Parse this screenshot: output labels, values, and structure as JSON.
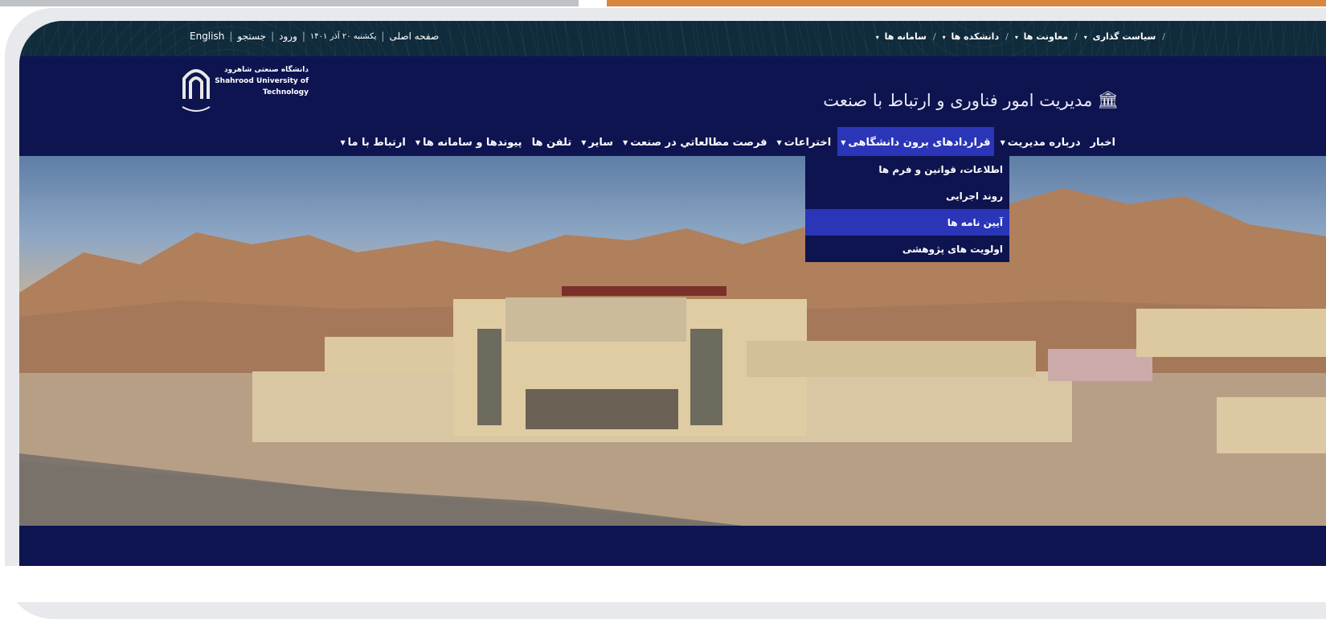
{
  "topbar": {
    "english": "English",
    "search": "جستجو",
    "login": "ورود",
    "date": "یکشنبه ۲۰ آذر ۱۴۰۱",
    "home": "صفحه اصلی",
    "right_links": [
      "سیاست گذاری",
      "معاونت ها",
      "دانشکده ها",
      "سامانه ها"
    ]
  },
  "header": {
    "university_fa": "دانشگاه صنعتی شاهرود",
    "university_en_1": "Shahrood University of",
    "university_en_2": "Technology",
    "site_title": "مدیریت امور فناوری و ارتباط با صنعت",
    "title_icon": "university-icon"
  },
  "nav": {
    "items": [
      {
        "label": "اخبار",
        "has_caret": false,
        "active": false
      },
      {
        "label": "درباره مدیریت",
        "has_caret": true,
        "active": false
      },
      {
        "label": "قراردادهای برون دانشگاهی",
        "has_caret": true,
        "active": true
      },
      {
        "label": "اختراعات",
        "has_caret": true,
        "active": false
      },
      {
        "label": "فرصت مطالعاتي در صنعت",
        "has_caret": true,
        "active": false
      },
      {
        "label": "سایر",
        "has_caret": true,
        "active": false
      },
      {
        "label": "تلفن ها",
        "has_caret": false,
        "active": false
      },
      {
        "label": "پیوندها و سامانه ها",
        "has_caret": true,
        "active": false
      },
      {
        "label": "ارتباط با ما",
        "has_caret": true,
        "active": false
      }
    ]
  },
  "dropdown": {
    "items": [
      {
        "label": "اطلاعات، قوانین و فرم ها",
        "active": false
      },
      {
        "label": "روند اجرایی",
        "active": false
      },
      {
        "label": "آیین نامه ها",
        "active": true
      },
      {
        "label": "اولویت های پژوهشی",
        "active": false
      }
    ]
  },
  "colors": {
    "navy": "#0e1450",
    "topbar": "#0f2b3c",
    "active": "#2a35b8"
  }
}
